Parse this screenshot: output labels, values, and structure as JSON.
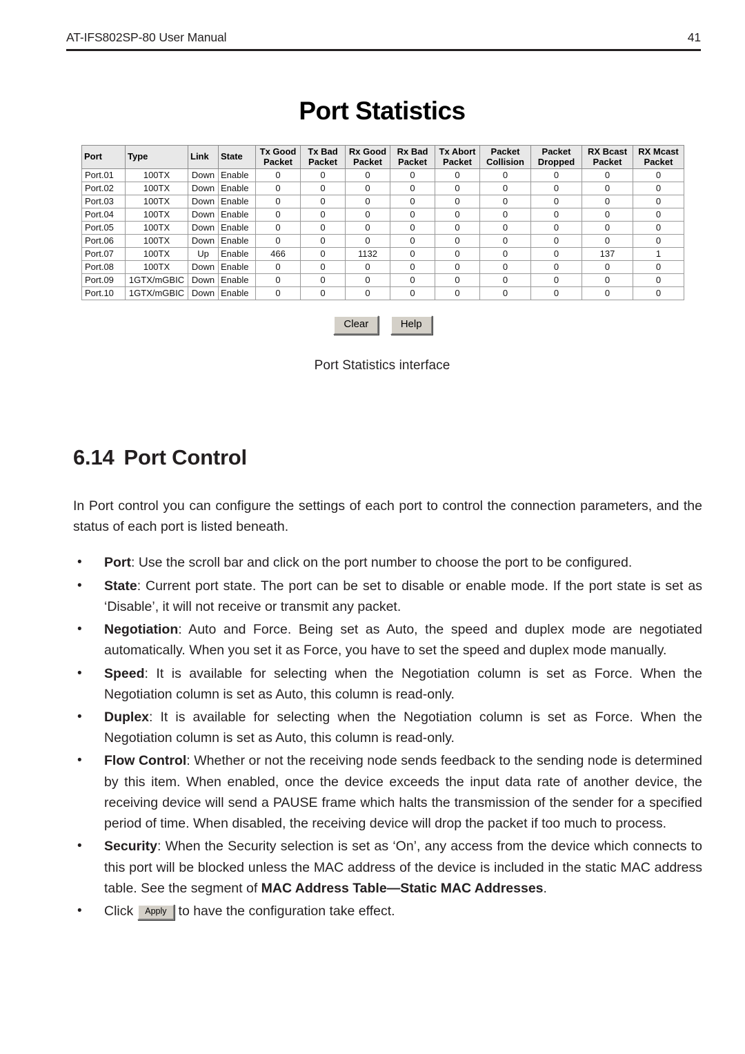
{
  "header": {
    "manual_title": "AT-IFS802SP-80 User Manual",
    "page_number": "41"
  },
  "figure": {
    "title": "Port Statistics",
    "caption": "Port Statistics interface",
    "buttons": [
      {
        "label": "Clear",
        "name": "clear-button"
      },
      {
        "label": "Help",
        "name": "help-button"
      }
    ],
    "table": {
      "columns": [
        "Port",
        "Type",
        "Link",
        "State",
        "Tx Good Packet",
        "Tx Bad Packet",
        "Rx Good Packet",
        "Rx Bad Packet",
        "Tx Abort Packet",
        "Packet Collision",
        "Packet Dropped",
        "RX Bcast Packet",
        "RX Mcast Packet"
      ],
      "column_lines": [
        [
          "Port",
          ""
        ],
        [
          "Type",
          ""
        ],
        [
          "Link",
          ""
        ],
        [
          "State",
          ""
        ],
        [
          "Tx Good",
          "Packet"
        ],
        [
          "Tx Bad",
          "Packet"
        ],
        [
          "Rx Good",
          "Packet"
        ],
        [
          "Rx Bad",
          "Packet"
        ],
        [
          "Tx Abort",
          "Packet"
        ],
        [
          "Packet",
          "Collision"
        ],
        [
          "Packet",
          "Dropped"
        ],
        [
          "RX Bcast",
          "Packet"
        ],
        [
          "RX Mcast",
          "Packet"
        ]
      ],
      "rows": [
        [
          "Port.01",
          "100TX",
          "Down",
          "Enable",
          "0",
          "0",
          "0",
          "0",
          "0",
          "0",
          "0",
          "0",
          "0"
        ],
        [
          "Port.02",
          "100TX",
          "Down",
          "Enable",
          "0",
          "0",
          "0",
          "0",
          "0",
          "0",
          "0",
          "0",
          "0"
        ],
        [
          "Port.03",
          "100TX",
          "Down",
          "Enable",
          "0",
          "0",
          "0",
          "0",
          "0",
          "0",
          "0",
          "0",
          "0"
        ],
        [
          "Port.04",
          "100TX",
          "Down",
          "Enable",
          "0",
          "0",
          "0",
          "0",
          "0",
          "0",
          "0",
          "0",
          "0"
        ],
        [
          "Port.05",
          "100TX",
          "Down",
          "Enable",
          "0",
          "0",
          "0",
          "0",
          "0",
          "0",
          "0",
          "0",
          "0"
        ],
        [
          "Port.06",
          "100TX",
          "Down",
          "Enable",
          "0",
          "0",
          "0",
          "0",
          "0",
          "0",
          "0",
          "0",
          "0"
        ],
        [
          "Port.07",
          "100TX",
          "Up",
          "Enable",
          "466",
          "0",
          "1132",
          "0",
          "0",
          "0",
          "0",
          "137",
          "1"
        ],
        [
          "Port.08",
          "100TX",
          "Down",
          "Enable",
          "0",
          "0",
          "0",
          "0",
          "0",
          "0",
          "0",
          "0",
          "0"
        ],
        [
          "Port.09",
          "1GTX/mGBIC",
          "Down",
          "Enable",
          "0",
          "0",
          "0",
          "0",
          "0",
          "0",
          "0",
          "0",
          "0"
        ],
        [
          "Port.10",
          "1GTX/mGBIC",
          "Down",
          "Enable",
          "0",
          "0",
          "0",
          "0",
          "0",
          "0",
          "0",
          "0",
          "0"
        ]
      ]
    }
  },
  "section": {
    "number": "6.14",
    "title": "Port Control",
    "intro": "In Port control you can configure the settings of each port to control the connection parameters, and the status of each port is listed beneath.",
    "bullets": [
      {
        "lead": "Port",
        "text": ": Use the scroll bar and click on the port number to choose the port to be configured."
      },
      {
        "lead": "State",
        "text": ": Current port state. The port can be set to disable or enable mode. If the port state is set as ‘Disable’, it will not receive or transmit any packet."
      },
      {
        "lead": "Negotiation",
        "text": ": Auto and Force. Being set as Auto, the speed and duplex mode are negotiated automatically. When you set it as Force, you have to set the speed and duplex mode manually."
      },
      {
        "lead": "Speed",
        "text": ": It is available for selecting when the Negotiation column is set as Force. When the Negotiation column is set as Auto, this column is read-only."
      },
      {
        "lead": "Duplex",
        "text": ": It is available for selecting when the Negotiation column is set as Force. When the Negotiation column is set as Auto, this column is read-only."
      },
      {
        "lead": "Flow Control",
        "text": ": Whether or not the receiving node sends feedback to the sending node is determined by this item. When enabled, once the device exceeds the input data rate of another device, the receiving device will send a PAUSE frame which halts the transmission of the sender for a specified period of time. When disabled, the receiving device will drop the packet if too much to process."
      },
      {
        "lead": "Security",
        "text": ": When the Security selection is set as ‘On’, any access from the device which connects to this port will be blocked unless the MAC address of the device is included in the static MAC address table. See the segment of ",
        "emph": "MAC Address Table—Static MAC Addresses",
        "tail": "."
      }
    ],
    "apply_bullet": {
      "pre": "Click",
      "button_label": "Apply",
      "post": "to have the configuration take effect."
    },
    "bullet_glyph": "•"
  }
}
